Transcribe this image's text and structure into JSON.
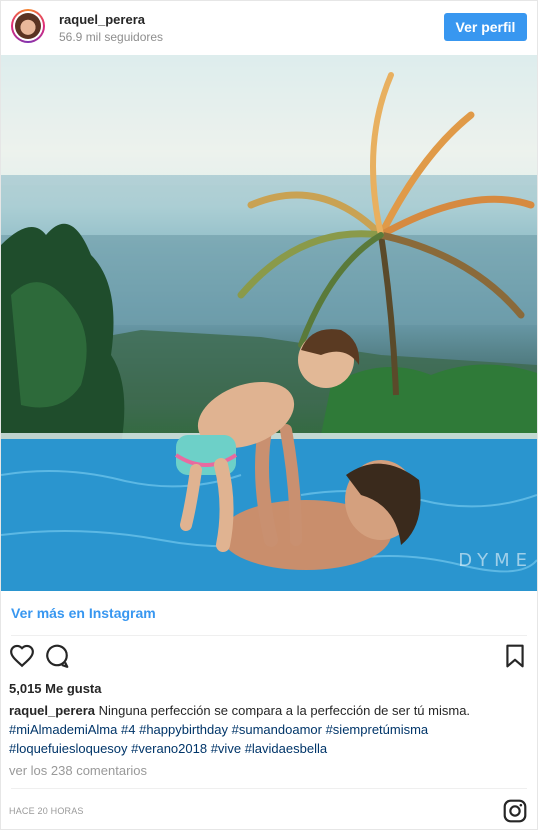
{
  "header": {
    "username": "raquel_perera",
    "followers": "56.9 mil seguidores",
    "view_profile_label": "Ver perfil"
  },
  "photo": {
    "watermark": "DYME"
  },
  "view_more_label": "Ver más en Instagram",
  "actions": {
    "icons": [
      "heart-icon",
      "comment-icon",
      "bookmark-icon"
    ]
  },
  "likes": "5,015 Me gusta",
  "caption": {
    "username": "raquel_perera",
    "text": "Ninguna perfección se compara a la perfección de ser tú misma.",
    "hashtags": [
      "#miAlmademiAlma",
      "#4",
      "#happybirthday",
      "#sumandoamor",
      "#siempretúmisma",
      "#loquefuiesloquesoy",
      "#verano2018",
      "#vive",
      "#lavidaesbella"
    ]
  },
  "comments_link": "ver los 238 comentarios",
  "timestamp": "HACE 20 HORAS",
  "colors": {
    "accent": "#3897f0",
    "hashtag": "#003569",
    "muted": "#8e8e8e"
  }
}
